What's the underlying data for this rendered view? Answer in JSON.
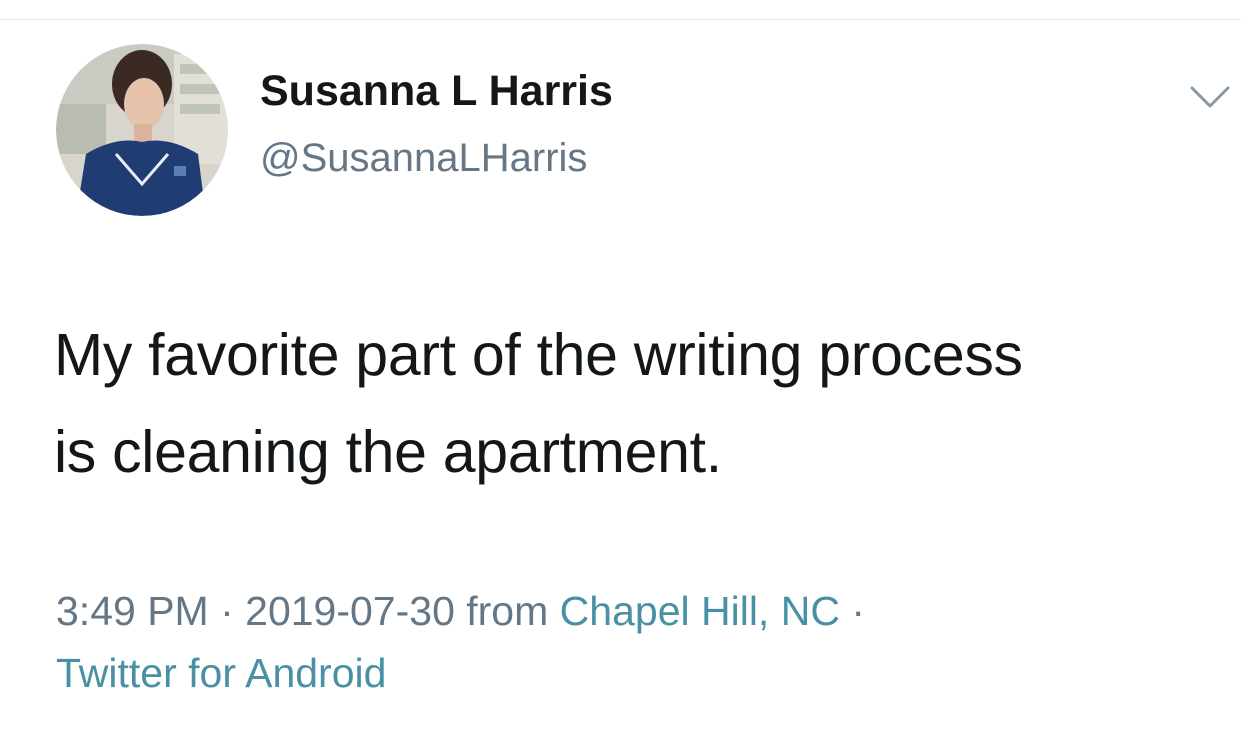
{
  "tweet": {
    "author": {
      "display_name": "Susanna L Harris",
      "handle": "@SusannaLHarris"
    },
    "text_lines": [
      "My favorite part of the writing process",
      "is cleaning the apartment."
    ],
    "meta": {
      "time": "3:49 PM",
      "separator": " · ",
      "date": "2019-07-30",
      "from_word": " from ",
      "location": "Chapel Hill, NC",
      "trailing_separator": " ·",
      "client": "Twitter for Android"
    },
    "menu_icon": "chevron-down-icon"
  },
  "colors": {
    "text": "#14171a",
    "secondary_text": "#657786",
    "link": "#4a90a4",
    "divider": "#e6ecf0"
  }
}
